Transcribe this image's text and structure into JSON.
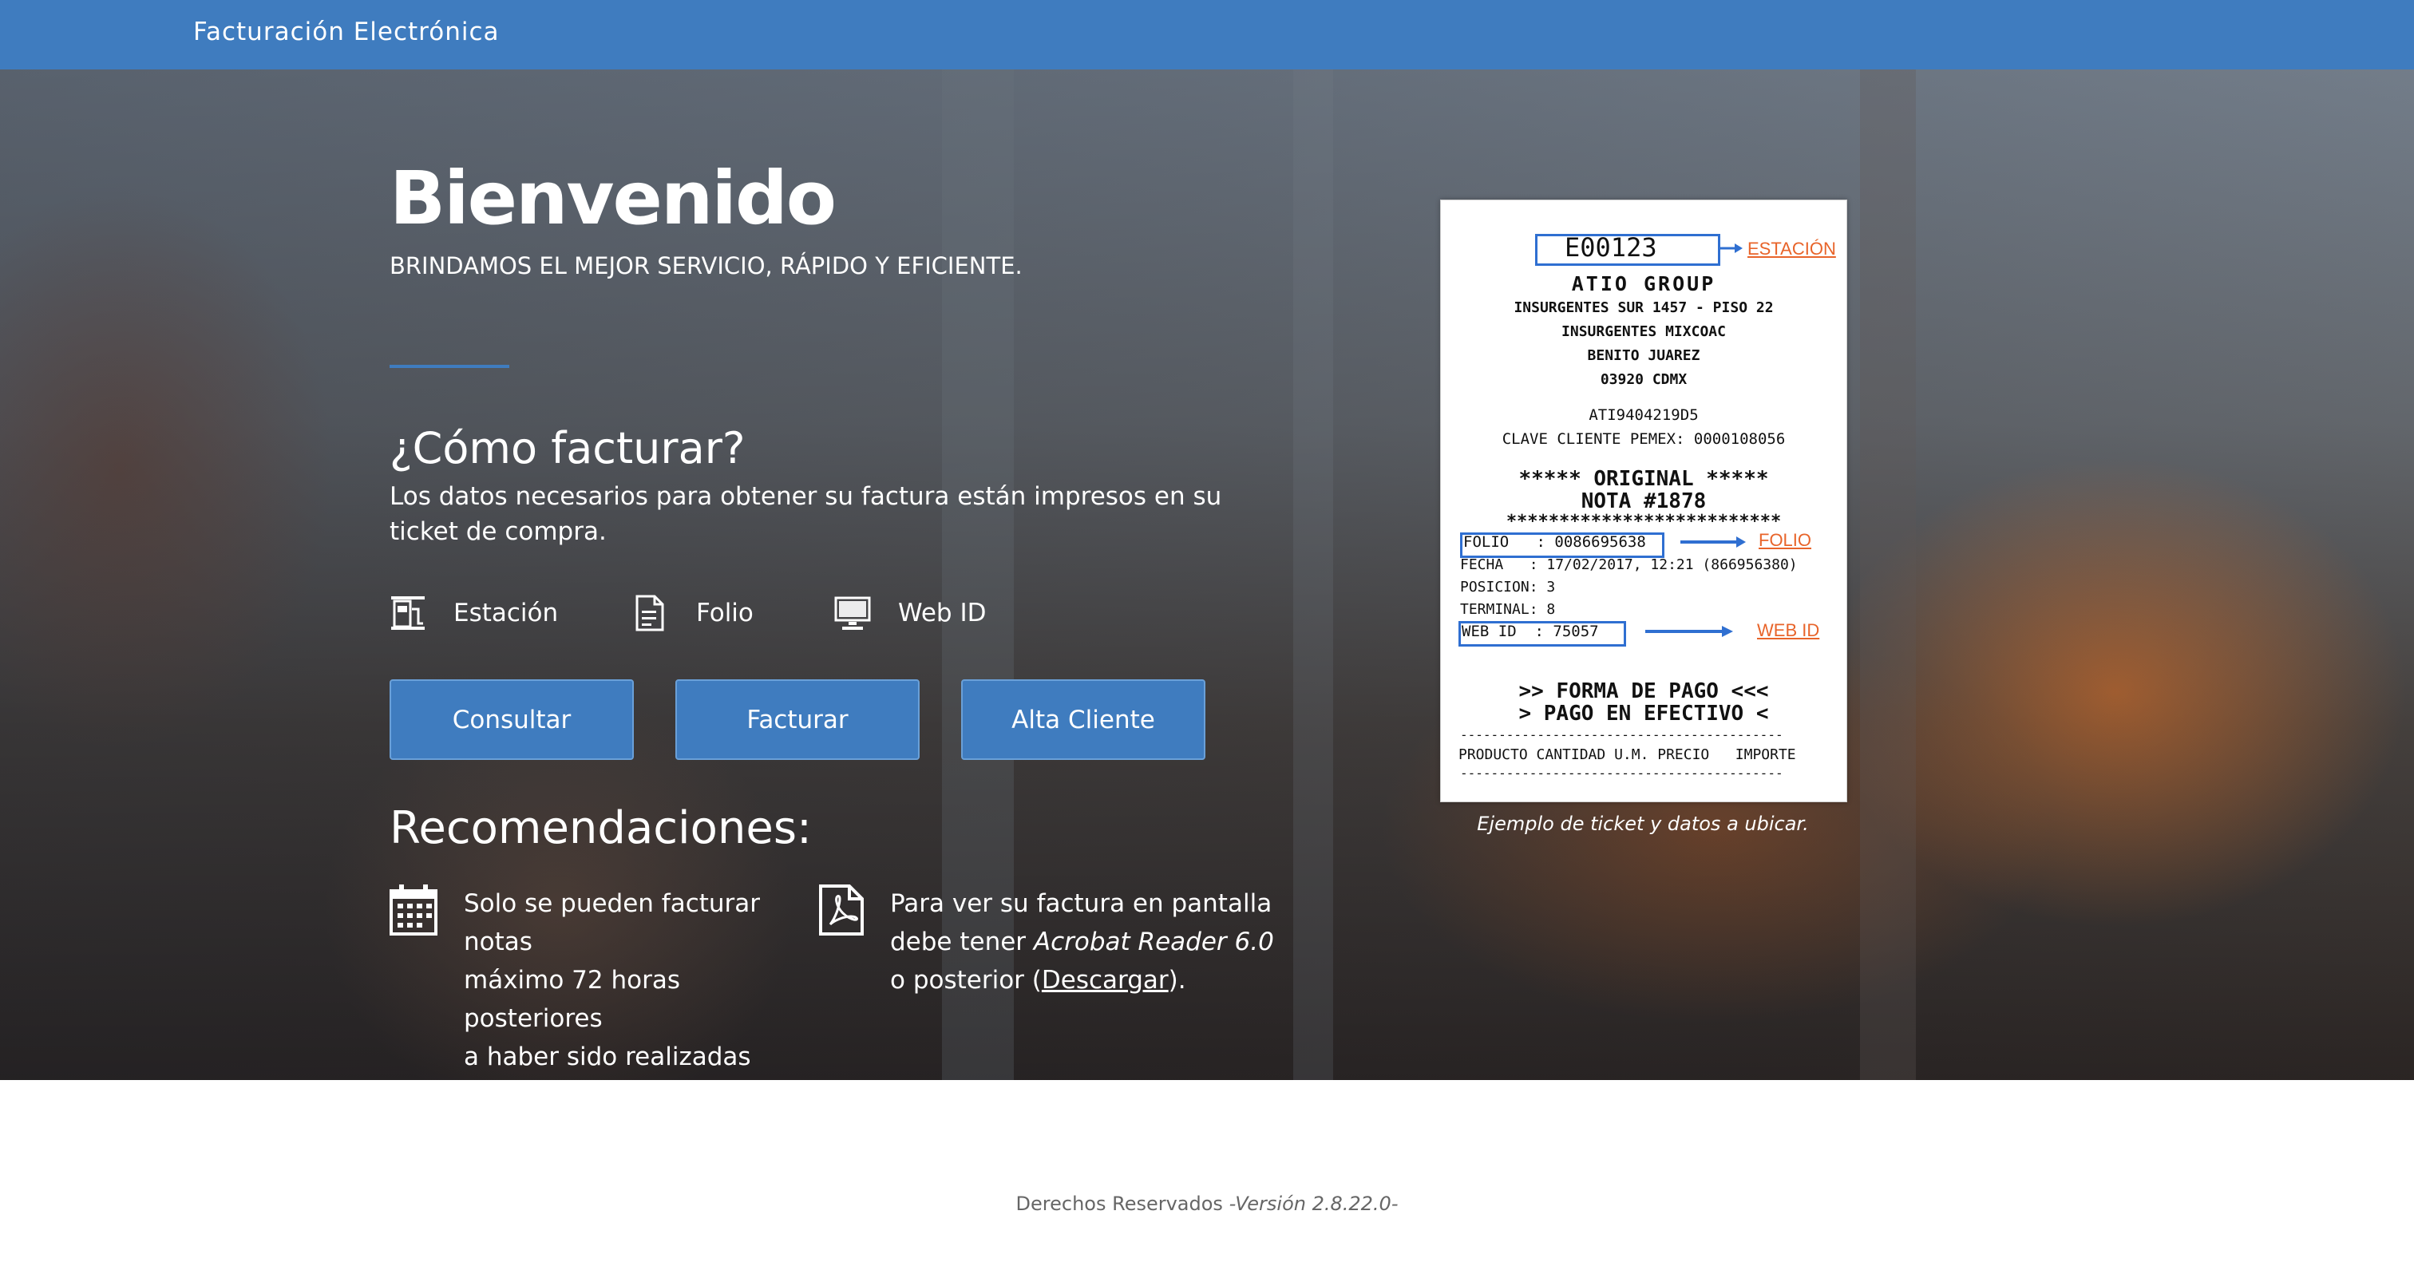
{
  "header": {
    "brand": "Facturación Electrónica"
  },
  "hero": {
    "title": "Bienvenido",
    "subtitle": "BRINDAMOS EL MEJOR SERVICIO, RÁPIDO Y EFICIENTE.",
    "how_title": "¿Cómo facturar?",
    "how_desc": "Los datos necesarios para obtener su factura están impresos en su ticket de compra.",
    "fields": [
      {
        "label": "Estación",
        "icon": "gas-station-icon"
      },
      {
        "label": "Folio",
        "icon": "document-icon"
      },
      {
        "label": "Web ID",
        "icon": "monitor-icon"
      }
    ],
    "buttons": {
      "consultar": "Consultar",
      "facturar": "Facturar",
      "alta_cliente": "Alta Cliente"
    },
    "rec_title": "Recomendaciones:",
    "rec1": {
      "line1": "Solo se pueden facturar notas",
      "line2": "máximo 72 horas posteriores",
      "line3": "a haber sido realizadas",
      "icon": "calendar-icon"
    },
    "rec2": {
      "line1": "Para ver su factura en pantalla",
      "line2_pre": "debe tener ",
      "line2_italic": "Acrobat Reader 6.0",
      "line3_pre": "o posterior (",
      "link": "Descargar",
      "line3_post": ").",
      "icon": "pdf-icon"
    }
  },
  "ticket": {
    "station_code": "E00123",
    "station_label": "ESTACIÓN",
    "company": "ATIO GROUP",
    "addr1": "INSURGENTES SUR 1457 - PISO 22",
    "addr2": "INSURGENTES MIXCOAC",
    "addr3": "BENITO JUAREZ",
    "addr4": "03920 CDMX",
    "rfc": "ATI9404219D5",
    "clave": "CLAVE CLIENTE PEMEX: 0000108056",
    "original": "***** ORIGINAL *****",
    "nota": "NOTA #1878",
    "stars": "**************************",
    "folio_line": "FOLIO   : 0086695638",
    "folio_label": "FOLIO",
    "fecha_line": "FECHA   : 17/02/2017, 12:21 (866956380)",
    "posicion_line": "POSICION: 3",
    "terminal_line": "TERMINAL: 8",
    "webid_line": "WEB ID  : 75057",
    "webid_label": "WEB ID",
    "forma1": ">> FORMA DE PAGO <<<",
    "forma2": "> PAGO EN EFECTIVO <",
    "dashes": "------------------------------------------",
    "cols": "PRODUCTO CANTIDAD U.M. PRECIO   IMPORTE",
    "caption": "Ejemplo de ticket y datos a ubicar.",
    "accent": "#e8642a",
    "box": "#2f6fd1"
  },
  "footer": {
    "text": "Derechos Reservados ",
    "version": "-Versión 2.8.22.0-"
  }
}
